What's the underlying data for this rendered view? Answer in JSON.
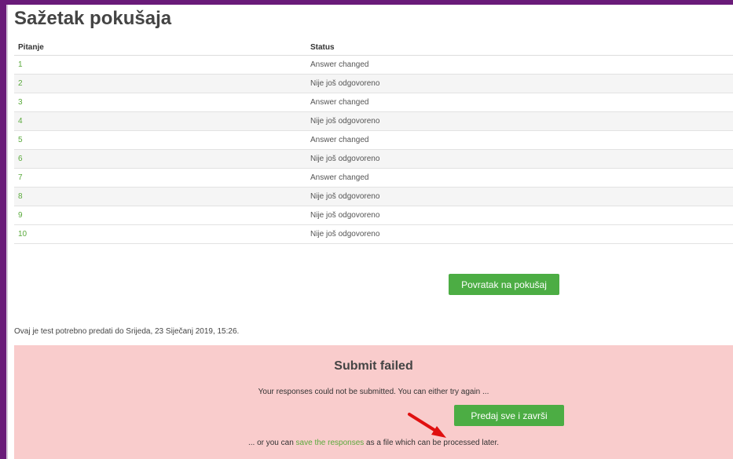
{
  "page": {
    "title": "Sažetak pokušaja"
  },
  "table": {
    "headers": {
      "question": "Pitanje",
      "status": "Status"
    },
    "rows": [
      {
        "question": "1",
        "status": "Answer changed"
      },
      {
        "question": "2",
        "status": "Nije još odgovoreno"
      },
      {
        "question": "3",
        "status": "Answer changed"
      },
      {
        "question": "4",
        "status": "Nije još odgovoreno"
      },
      {
        "question": "5",
        "status": "Answer changed"
      },
      {
        "question": "6",
        "status": "Nije još odgovoreno"
      },
      {
        "question": "7",
        "status": "Answer changed"
      },
      {
        "question": "8",
        "status": "Nije još odgovoreno"
      },
      {
        "question": "9",
        "status": "Nije još odgovoreno"
      },
      {
        "question": "10",
        "status": "Nije još odgovoreno"
      }
    ]
  },
  "actions": {
    "back_label": "Povratak na pokušaj"
  },
  "deadline_text": "Ovaj je test potrebno predati do Srijeda, 23 Siječanj 2019, 15:26.",
  "submit_failed": {
    "title": "Submit failed",
    "message": "Your responses could not be submitted. You can either try again ...",
    "submit_label": "Predaj sve i završi",
    "alt_prefix": "... or you can ",
    "alt_link": "save the responses",
    "alt_suffix": " as a file which can be processed later."
  },
  "colors": {
    "frame": "#6a1b79",
    "accent_green": "#4cad44",
    "link_green": "#5aaa3c",
    "error_bg": "#f9cccc",
    "annotation_arrow": "#e01010"
  },
  "icons": {
    "annotation": "red-arrow-icon"
  }
}
